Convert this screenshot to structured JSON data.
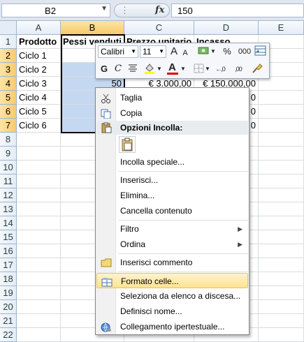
{
  "formula_bar": {
    "name_box": "B2",
    "fx_label": "fx",
    "value": "150"
  },
  "columns": [
    "A",
    "B",
    "C",
    "D",
    "E"
  ],
  "rows": [
    "1",
    "2",
    "3",
    "4",
    "5",
    "6",
    "7",
    "8",
    "9",
    "10",
    "11",
    "12",
    "13",
    "14",
    "15",
    "16",
    "17",
    "18",
    "19",
    "20",
    "21",
    "22"
  ],
  "cells": {
    "A1": "Prodotto",
    "B1": "Pessi venduti",
    "C1": "Prezzo unitario",
    "D1": "Incasso",
    "A2": "Ciclo 1",
    "A3": "Ciclo 2",
    "A4": "Ciclo 3",
    "A5": "Ciclo 4",
    "A6": "Ciclo 5",
    "A7": "Ciclo 6",
    "B4": "50",
    "C4": "€ 3.000,00",
    "D4": "€ 150.000,00",
    "D5": "0",
    "D6": "0",
    "D7": "0"
  },
  "mini_toolbar": {
    "font_name": "Calibri",
    "font_size": "11",
    "grow_font": "A",
    "shrink_font": "A",
    "percent": "%",
    "thousands": "000",
    "bold": "G",
    "italic": "C",
    "font_color_letter": "A",
    "increase_decimal": "←,0",
    "decrease_decimal": ",00",
    "colors": {
      "highlight": "#ffff00",
      "font_color": "#e00000"
    }
  },
  "context_menu": {
    "items": [
      {
        "label": "Taglia",
        "icon": "scissors-icon"
      },
      {
        "label": "Copia",
        "icon": "copy-icon"
      },
      {
        "label": "Opzioni Incolla:",
        "icon": "paste-options-icon"
      },
      {
        "label": "Incolla speciale..."
      },
      {
        "label": "Inserisci..."
      },
      {
        "label": "Elimina..."
      },
      {
        "label": "Cancella contenuto"
      },
      {
        "label": "Filtro",
        "submenu": "▶"
      },
      {
        "label": "Ordina",
        "submenu": "▶"
      },
      {
        "label": "Inserisci commento",
        "icon": "comment-icon"
      },
      {
        "label": "Formato celle...",
        "icon": "format-cells-icon"
      },
      {
        "label": "Seleziona da elenco a discesa..."
      },
      {
        "label": "Definisci nome..."
      },
      {
        "label": "Collegamento ipertestuale...",
        "icon": "hyperlink-icon"
      }
    ]
  },
  "colors": {
    "selection_fill": "#c5d8f1",
    "header_selected": "#f8ca6b",
    "menu_highlight": "#fde393"
  }
}
